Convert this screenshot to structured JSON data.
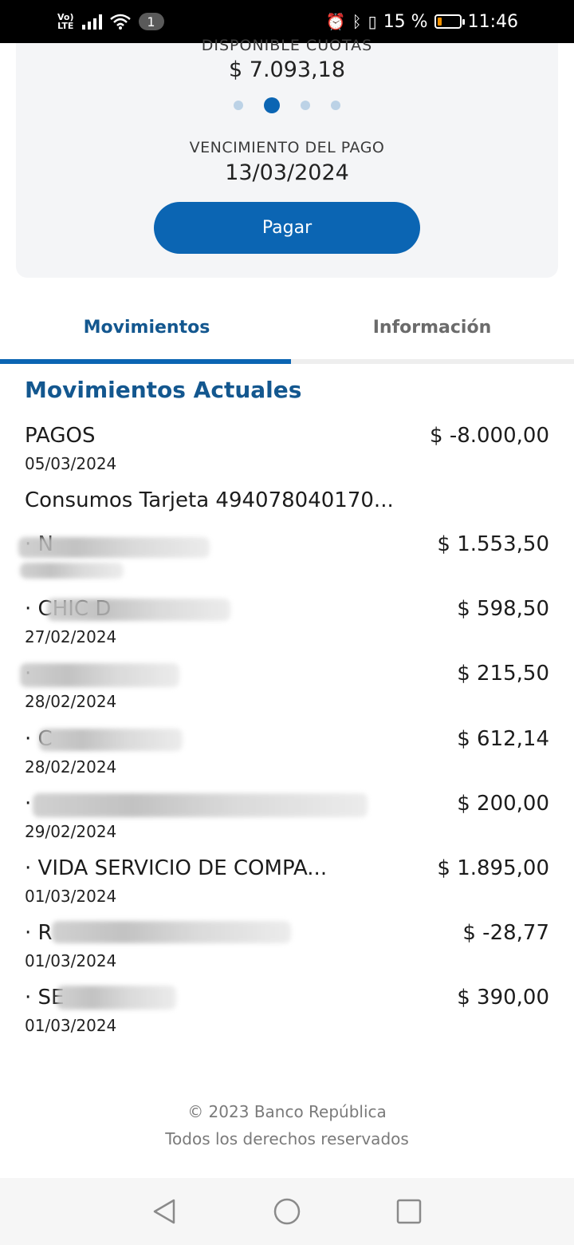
{
  "status_bar": {
    "network": "VoLTE",
    "notification_count": "1",
    "battery_percent": "15 %",
    "time": "11:46"
  },
  "card": {
    "available_label": "DISPONIBLE CUOTAS",
    "available_amount": "$ 7.093,18",
    "carousel_pages": 4,
    "carousel_active_page": 2,
    "due_label": "VENCIMIENTO DEL PAGO",
    "due_date": "13/03/2024",
    "pay_label": "Pagar"
  },
  "tabs": [
    {
      "label": "Movimientos",
      "active": true
    },
    {
      "label": "Información",
      "active": false
    }
  ],
  "section_title": "Movimientos Actuales",
  "payments": {
    "description": "PAGOS",
    "date": "05/03/2024",
    "amount": "$ -8.000,00"
  },
  "card_group_label": "Consumos Tarjeta 494078040170...",
  "movements": [
    {
      "description": "· N",
      "date": "",
      "amount": "$ 1.553,50"
    },
    {
      "description": "· CHIC D",
      "date": "27/02/2024",
      "amount": "$ 598,50"
    },
    {
      "description": "·",
      "date": "28/02/2024",
      "amount": "$ 215,50"
    },
    {
      "description": "· C",
      "date": "28/02/2024",
      "amount": "$ 612,14"
    },
    {
      "description": "·",
      "date": "29/02/2024",
      "amount": "$ 200,00"
    },
    {
      "description": "· VIDA SERVICIO DE COMPA...",
      "date": "01/03/2024",
      "amount": "$ 1.895,00"
    },
    {
      "description": "· R",
      "date": "01/03/2024",
      "amount": "$ -28,77"
    },
    {
      "description": "· SE",
      "date": "01/03/2024",
      "amount": "$ 390,00"
    }
  ],
  "footer": {
    "copyright": "© 2023 Banco República",
    "rights": "Todos los derechos reservados"
  },
  "colors": {
    "primary": "#0b65b3",
    "title": "#13578f",
    "battery_low": "#f39200"
  }
}
